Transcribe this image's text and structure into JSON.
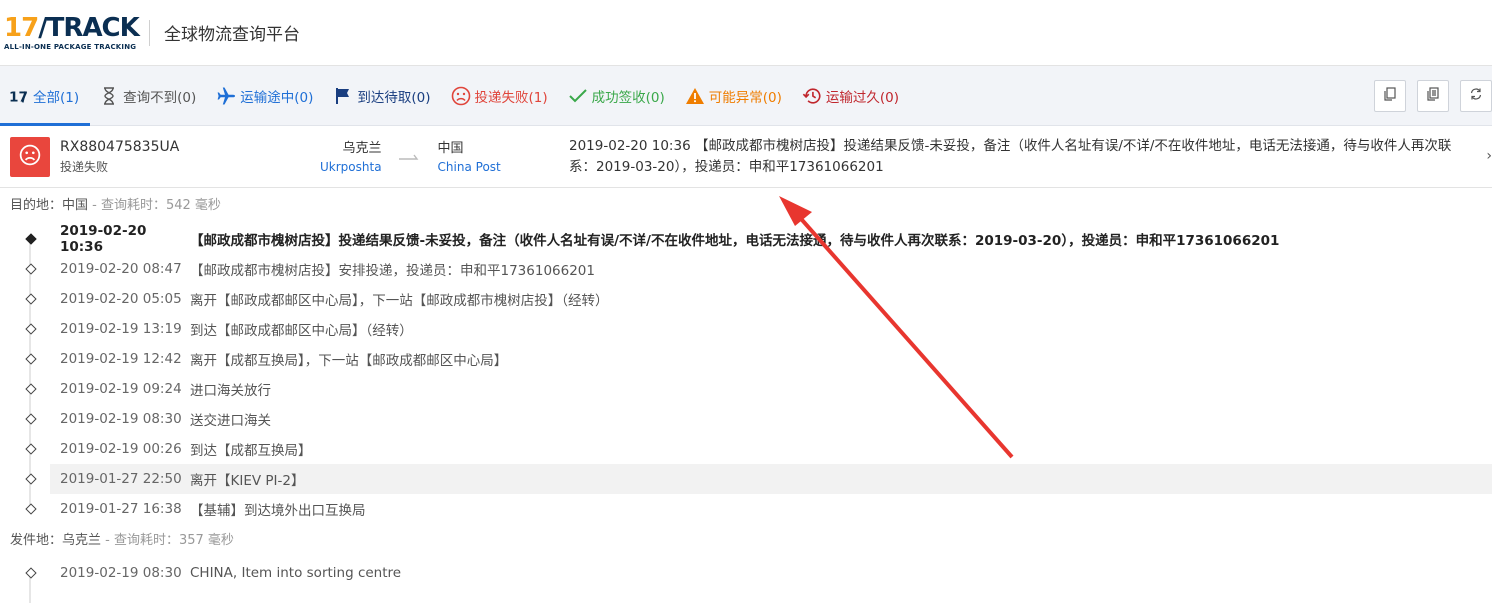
{
  "header": {
    "logo_main": "17TRACK",
    "logo_sub": "ALL-IN-ONE PACKAGE TRACKING",
    "title": "全球物流查询平台"
  },
  "tabs": [
    {
      "label": "全部(1)",
      "icon": "17-logo-icon",
      "active": true
    },
    {
      "label": "查询不到(0)",
      "icon": "hourglass-icon"
    },
    {
      "label": "运输途中(0)",
      "icon": "airplane-icon"
    },
    {
      "label": "到达待取(0)",
      "icon": "flag-icon"
    },
    {
      "label": "投递失败(1)",
      "icon": "sad-face-icon"
    },
    {
      "label": "成功签收(0)",
      "icon": "checkmark-icon"
    },
    {
      "label": "可能异常(0)",
      "icon": "warning-icon"
    },
    {
      "label": "运输过久(0)",
      "icon": "clock-history-icon"
    }
  ],
  "colors": {
    "accent": "#1f6fd6",
    "fail": "#e9463d",
    "delivered": "#3aa84a",
    "alert": "#ef7d00",
    "expired": "#c0262d",
    "annotation_arrow": "#e8362f"
  },
  "summary": {
    "tracking_number": "RX880475835UA",
    "status": "投递失败",
    "origin_country": "乌克兰",
    "origin_carrier": "Ukrposhta",
    "dest_country": "中国",
    "dest_carrier": "China Post",
    "latest_event": "2019-02-20 10:36 【邮政成都市槐树店投】投递结果反馈-未妥投，备注（收件人名址有误/不详/不在收件地址，电话无法接通，待与收件人再次联系：2019-03-20），投递员：申和平17361066201"
  },
  "destination": {
    "label": "目的地：中国",
    "query_time": " - 查询耗时：542 毫秒",
    "events": [
      {
        "time": "2019-02-20 10:36",
        "desc": "【邮政成都市槐树店投】投递结果反馈-未妥投，备注（收件人名址有误/不详/不在收件地址，电话无法接通，待与收件人再次联系：2019-03-20），投递员：申和平17361066201"
      },
      {
        "time": "2019-02-20 08:47",
        "desc": "【邮政成都市槐树店投】安排投递，投递员：申和平17361066201"
      },
      {
        "time": "2019-02-20 05:05",
        "desc": "离开【邮政成都邮区中心局】，下一站【邮政成都市槐树店投】（经转）"
      },
      {
        "time": "2019-02-19 13:19",
        "desc": "到达【邮政成都邮区中心局】（经转）"
      },
      {
        "time": "2019-02-19 12:42",
        "desc": "离开【成都互换局】，下一站【邮政成都邮区中心局】"
      },
      {
        "time": "2019-02-19 09:24",
        "desc": "进口海关放行"
      },
      {
        "time": "2019-02-19 08:30",
        "desc": "送交进口海关"
      },
      {
        "time": "2019-02-19 00:26",
        "desc": "到达【成都互换局】"
      },
      {
        "time": "2019-01-27 22:50",
        "desc": "离开【KIEV PI-2】"
      },
      {
        "time": "2019-01-27 16:38",
        "desc": "【基辅】到达境外出口互换局"
      }
    ]
  },
  "origin": {
    "label": "发件地：乌克兰",
    "query_time": " - 查询耗时：357 毫秒",
    "events": [
      {
        "time": "2019-02-19 08:30",
        "desc": "CHINA, Item into sorting centre"
      }
    ]
  }
}
